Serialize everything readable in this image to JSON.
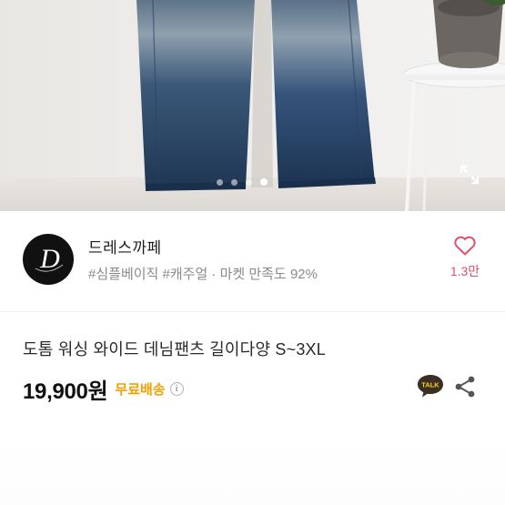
{
  "gallery": {
    "slide_count": 4,
    "active_index": 3,
    "expand_icon": "expand-icon"
  },
  "shop": {
    "logo_letter": "D",
    "name": "드레스까페",
    "tag_1": "#심플베이직",
    "tag_2": "#캐주얼",
    "separator": " · ",
    "satisfaction": "마켓 만족도 92%",
    "like_count": "1.3만",
    "like_icon": "heart-icon"
  },
  "product": {
    "title": "도톰 워싱 와이드 데님팬츠 길이다양 S~3XL",
    "price": "19,900원",
    "shipping": "무료배송",
    "info_icon_glyph": "i",
    "talk_label": "TALK"
  },
  "colors": {
    "accent_pink": "#e0506a",
    "shipping_orange": "#f0a000",
    "talk_yellow": "#f7d71c"
  }
}
